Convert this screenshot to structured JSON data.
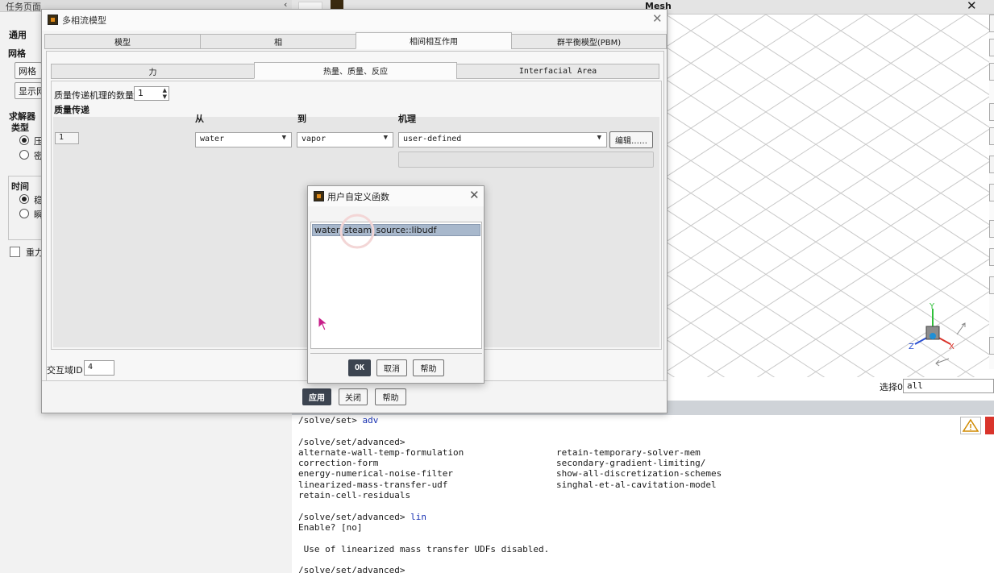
{
  "task_panel": {
    "title": "任务页面",
    "collapse_glyph": "‹",
    "general": "通用",
    "mesh": "网格",
    "mesh_button": "网格",
    "display_button": "显示网",
    "solver": "求解器",
    "type": "类型",
    "type_opt1": "压",
    "type_opt2": "密",
    "time": "时间",
    "time_opt1": "稳",
    "time_opt2": "瞬",
    "gravity": "重力"
  },
  "graphics": {
    "title": "Mesh",
    "close": "✕",
    "select_label": "选择0",
    "select_value": "all",
    "axes": {
      "x": "X",
      "y": "Y",
      "z": "Z"
    }
  },
  "console": {
    "lines": [
      {
        "prompt": "/solve/set> ",
        "cmd": "adv"
      },
      {
        "prompt": "",
        "cmd": ""
      },
      {
        "prompt": "/solve/set/advanced>",
        "cmd": ""
      },
      {
        "prompt": "alternate-wall-temp-formulation",
        "cmd": "",
        "col2": "retain-temporary-solver-mem"
      },
      {
        "prompt": "correction-form",
        "cmd": "",
        "col2": "secondary-gradient-limiting/"
      },
      {
        "prompt": "energy-numerical-noise-filter",
        "cmd": "",
        "col2": "show-all-discretization-schemes"
      },
      {
        "prompt": "linearized-mass-transfer-udf",
        "cmd": "",
        "col2": "singhal-et-al-cavitation-model"
      },
      {
        "prompt": "retain-cell-residuals",
        "cmd": ""
      },
      {
        "prompt": "",
        "cmd": ""
      },
      {
        "prompt": "/solve/set/advanced> ",
        "cmd": "lin"
      },
      {
        "prompt": "Enable? [no]",
        "cmd": ""
      },
      {
        "prompt": "",
        "cmd": ""
      },
      {
        "prompt": " Use of linearized mass transfer UDFs disabled.",
        "cmd": ""
      },
      {
        "prompt": "",
        "cmd": ""
      },
      {
        "prompt": "/solve/set/advanced>",
        "cmd": ""
      }
    ]
  },
  "multiphase_dialog": {
    "title": "多相流模型",
    "close": "✕",
    "tabs": [
      "模型",
      "相",
      "相间相互作用",
      "群平衡模型(PBM)"
    ],
    "active_tab": 2,
    "subtabs": [
      "力",
      "热量、质量、反应",
      "Interfacial Area"
    ],
    "active_subtab": 1,
    "num_mechanisms_label": "质量传递机理的数量",
    "num_mechanisms_value": "1",
    "mass_transfer_label": "质量传递",
    "col_from": "从",
    "col_to": "到",
    "col_mechanism": "机理",
    "row_number": "1",
    "from_value": "water",
    "to_value": "vapor",
    "mechanism_value": "user-defined",
    "edit_button": "编辑……",
    "domain_id_label": "交互域ID",
    "domain_id_value": "4",
    "apply": "应用",
    "close_button": "关闭",
    "help": "帮助"
  },
  "udf_dialog": {
    "title": "用户自定义函数",
    "close": "✕",
    "items": [
      "water_steam_source::libudf"
    ],
    "ok": "OK",
    "cancel": "取消",
    "help": "帮助"
  }
}
